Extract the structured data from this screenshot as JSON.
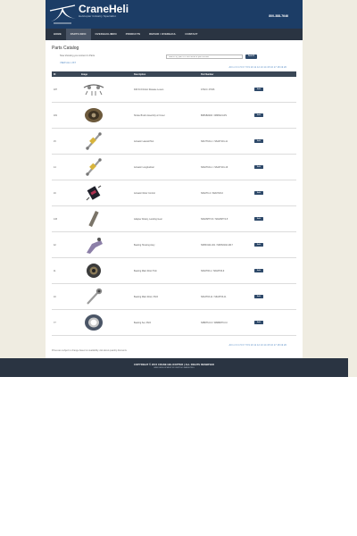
{
  "header": {
    "brand": "CraneHeli",
    "tagline": "Helicopter Industry Specialist",
    "phone": "800-388-7646"
  },
  "nav": {
    "items": [
      "HOME",
      "PARTS INFO",
      "OVERHAUL/MRO",
      "PRODUCTS",
      "REPAIR / OVERHAUL",
      "CONTACT"
    ]
  },
  "catalog": {
    "title": "Parts Catalog",
    "intro": "Now showing you content in Parts",
    "view_all": "VIEW ALL LIST",
    "search_placeholder": "Search by part # or text about a part number",
    "search_button": "Search",
    "pager_top": "All 1 2 3 4 5 6 7 8 9 10 11 12 13 14 15 16 17 18 19 20",
    "pager_bottom": "All 1 2 3 4 5 6 7 8 9 10 11 12 13 14 15 16 17 18 19 20",
    "columns": [
      "ID",
      "Image",
      "Description",
      "Part Number",
      ""
    ],
    "add_label": "Add",
    "rows": [
      {
        "id": "187",
        "description": "Drill Kit Friction Release Levers",
        "part": "47024 / 47026",
        "icon": "release-levers"
      },
      {
        "id": "181",
        "description": "Stroke Brush Assembly w/ Cover",
        "part": "B08SB221R / 08R6221-RS",
        "icon": "brush-assembly"
      },
      {
        "id": "15",
        "description": "Actuator Lateral Pitot",
        "part": "S6A7T101-1 / S6A0T101-11",
        "icon": "actuator"
      },
      {
        "id": "14",
        "description": "Actuator Longitudinal",
        "part": "S6A0T101-1 / S6A0T101-16",
        "icon": "actuator"
      },
      {
        "id": "16",
        "description": "Actuator Rotor Control",
        "part": "S6A0T0-4 / S6A0T20-6",
        "icon": "rotor-control"
      },
      {
        "id": "133",
        "description": "Adapter Rotary, Landing Gear",
        "part": "S6A6SHT3-5 / S6A6SHT4-5",
        "icon": "adapter"
      },
      {
        "id": "42",
        "description": "Bearing Housing Assy",
        "part": "S6RS3114-401 / S6RS3102-4017",
        "icon": "bearing-housing"
      },
      {
        "id": "11",
        "description": "Bearing Main Rotor Hub",
        "part": "S6A6T06-1 / S6A6T06-9",
        "icon": "bearing-hub"
      },
      {
        "id": "10",
        "description": "Bearing Main Rotor, Pitch",
        "part": "S6A3T03-11 / S6A3T03-11",
        "icon": "pitch-link"
      },
      {
        "id": "77",
        "description": "Bearing Set, Pitch",
        "part": "S6B6T6-6.0 / W6B6RT6.0.0",
        "icon": "bearing-set"
      }
    ],
    "footnote": "Prices are subject to change based on availability. Ask about quantity discounts."
  },
  "footer": {
    "copyright": "COPYRIGHT © 2015 CRANE HELICOPTER   |   ALL RIGHTS RESERVED",
    "credit": "WEB DEVELOPMENT BY VERTIGO MARKETING"
  }
}
